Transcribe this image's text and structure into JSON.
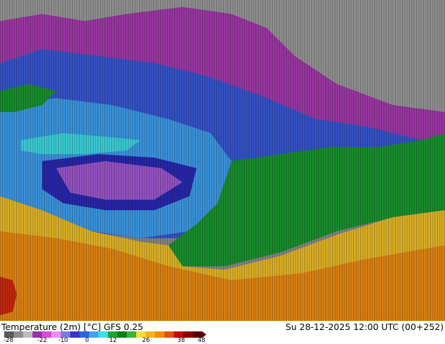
{
  "map": {
    "type": "temperature-field",
    "legend_colors": [
      "#5a5a5a",
      "#8c8c8c",
      "#bdbdbd",
      "#9a2fa8",
      "#d34fd8",
      "#ef8cf0",
      "#7a7ae0",
      "#3636c8",
      "#2b66e0",
      "#3fa4f0",
      "#3ce0e8",
      "#19a838",
      "#0a7d1a",
      "#3cb43c",
      "#f0e13a",
      "#f5b21a",
      "#f08c0a",
      "#e05010",
      "#c80a0a",
      "#8c0000",
      "#5a0000"
    ]
  },
  "footer": {
    "title": "Temperature (2m) [°C] GFS 0.25",
    "valid": "Su 28-12-2025 12:00 UTC (00+252)",
    "ticks": [
      "-28",
      "-22",
      "-10",
      "0",
      "12",
      "26",
      "38",
      "48"
    ]
  }
}
